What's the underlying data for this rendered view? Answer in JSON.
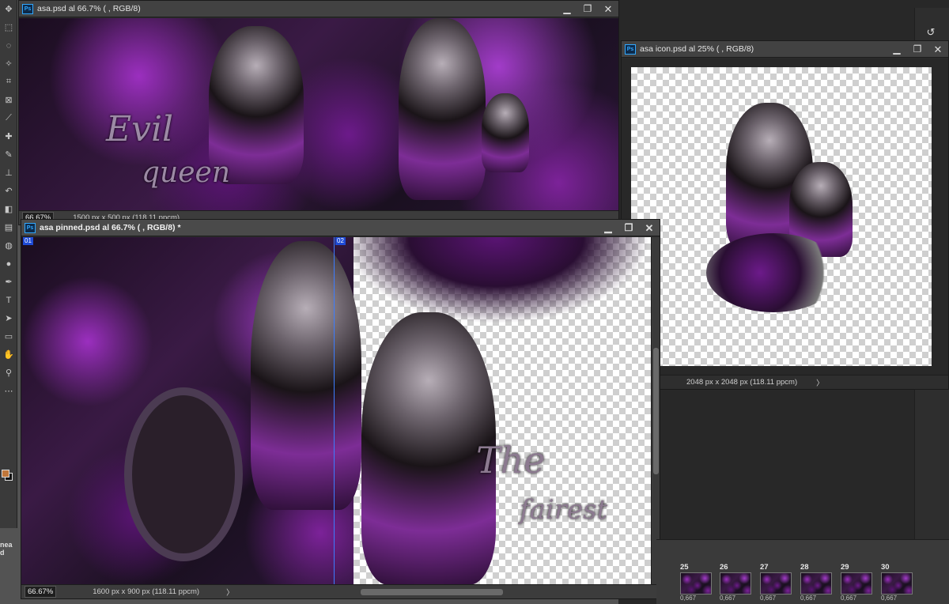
{
  "app": {
    "name": "Photoshop",
    "ps_badge": "Ps"
  },
  "toolbar": {
    "tools": [
      "move-icon",
      "marquee-icon",
      "lasso-icon",
      "magic-wand-icon",
      "crop-icon",
      "frame-icon",
      "eyedropper-icon",
      "healing-icon",
      "brush-icon",
      "stamp-icon",
      "history-brush-icon",
      "eraser-icon",
      "gradient-icon",
      "blur-icon",
      "dodge-icon",
      "pen-icon",
      "type-icon",
      "path-select-icon",
      "shape-icon",
      "hand-icon",
      "zoom-icon",
      "more-icon"
    ],
    "type_glyph": "T",
    "colors": {
      "foreground": "#c0773a",
      "background": "#111111"
    }
  },
  "windows": {
    "asa": {
      "title": "asa.psd al 66.7% ( , RGB/8)",
      "zoom": "66.67%",
      "doc_size": "1500 px x 500 px (118.11 ppcm)",
      "deco_line1": "Evil",
      "deco_line2": "queen"
    },
    "asa_pinned": {
      "title": "asa pinned.psd al 66.7% ( , RGB/8) *",
      "zoom": "66.67%",
      "doc_size": "1600 px x 900 px (118.11 ppcm)",
      "slice_1": "01",
      "slice_2": "02",
      "deco_line1": "The",
      "deco_line2": "fairest"
    },
    "asa_icon": {
      "title": "asa icon.psd al 25% ( , RGB/8)",
      "doc_size": "2048 px x 2048 px (118.11 ppcm)"
    }
  },
  "window_controls": {
    "minimize": "▁",
    "restore": "❐",
    "close": "✕"
  },
  "timeline": {
    "label": "nea d",
    "frames": [
      "25",
      "26",
      "27",
      "28",
      "29",
      "30"
    ],
    "frame_time": "0,667"
  }
}
